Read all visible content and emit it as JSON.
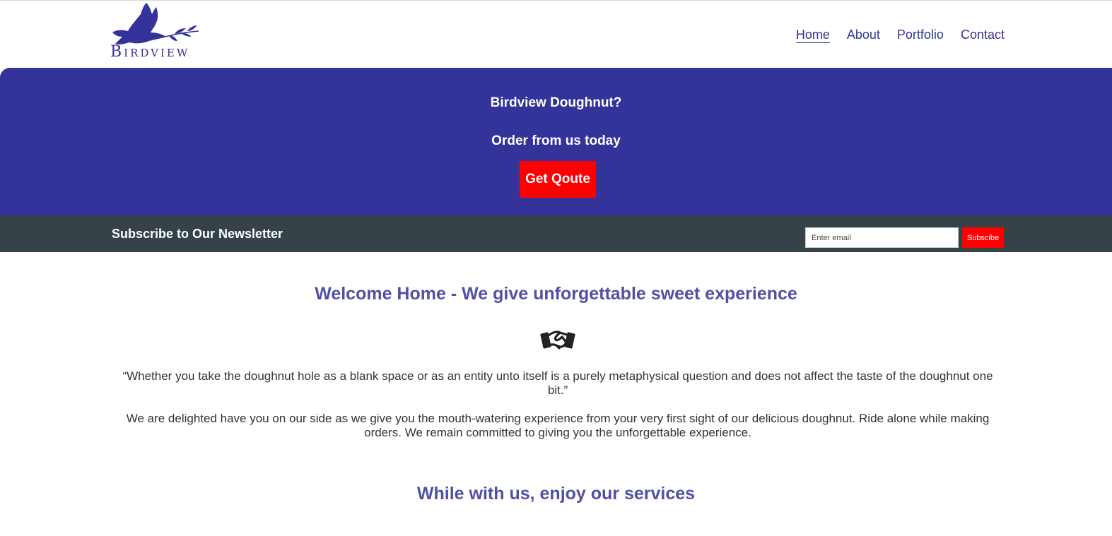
{
  "logo": {
    "text": "Birdview",
    "icon": "dove-icon"
  },
  "nav": [
    {
      "label": "Home",
      "active": true
    },
    {
      "label": "About",
      "active": false
    },
    {
      "label": "Portfolio",
      "active": false
    },
    {
      "label": "Contact",
      "active": false
    }
  ],
  "hero": {
    "title": "Birdview Doughnut?",
    "subtitle": "Order from us today",
    "button": "Get Qoute"
  },
  "newsletter": {
    "title": "Subscribe to Our Newsletter",
    "placeholder": "Enter email",
    "button": "Subscibe"
  },
  "main": {
    "heading": "Welcome Home - We give unforgettable sweet experience",
    "icon": "handshake-icon",
    "quote": "“Whether you take the doughnut hole as a blank space or as an entity unto itself is a purely metaphysical question and does not affect the taste of the doughnut one bit.”",
    "paragraph": "We are delighted have you on our side as we give you the mouth-watering experience from your very first sight of our delicious doughnut. Ride alone while making orders. We remain committed to giving you the unforgettable experience.",
    "services_heading": "While with us, enjoy our services"
  },
  "colors": {
    "brand": "#343399",
    "accent": "#ff0000",
    "newsletter_bg": "#354248",
    "heading": "#5050a8"
  }
}
